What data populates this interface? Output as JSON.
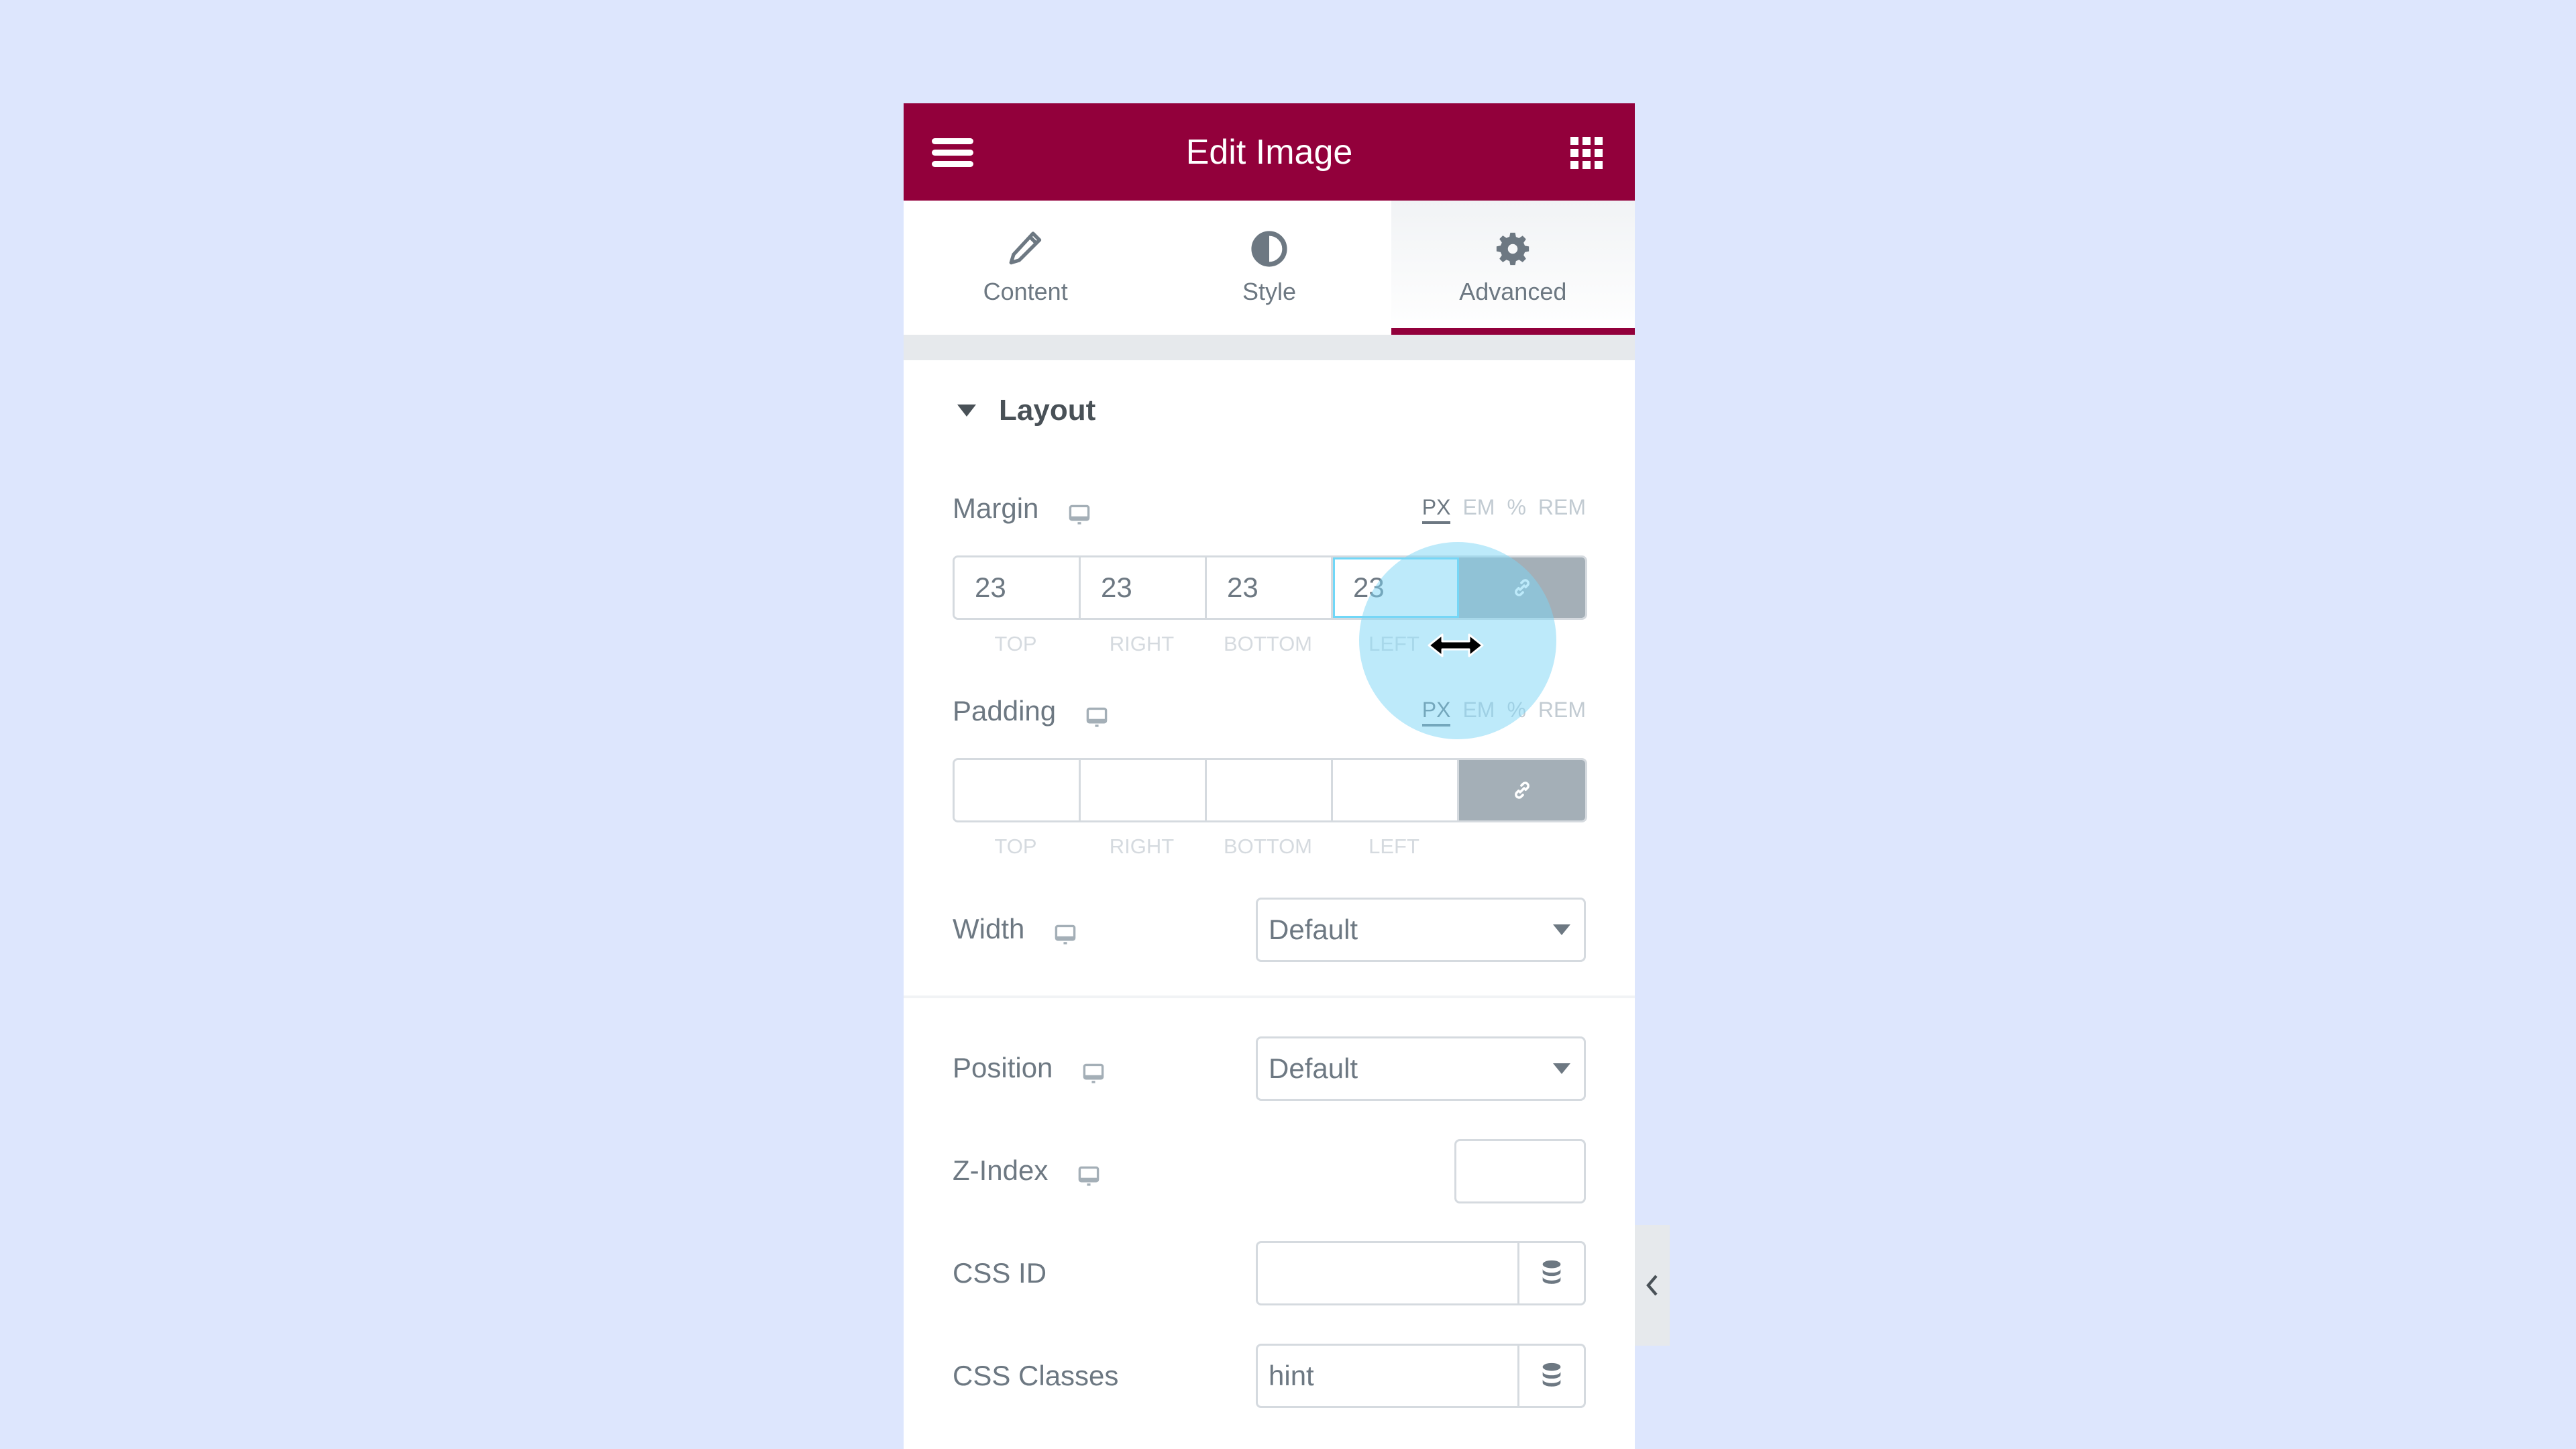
{
  "header": {
    "title": "Edit Image",
    "menu_icon": "hamburger-icon",
    "apps_icon": "grid-icon"
  },
  "tabs": [
    {
      "label": "Content",
      "icon": "pencil-icon",
      "active": false
    },
    {
      "label": "Style",
      "icon": "half-circle-icon",
      "active": false
    },
    {
      "label": "Advanced",
      "icon": "gear-icon",
      "active": true
    }
  ],
  "section": {
    "title": "Layout"
  },
  "margin": {
    "label": "Margin",
    "units": [
      "PX",
      "EM",
      "%",
      "REM"
    ],
    "active_unit": "PX",
    "values": {
      "top": "23",
      "right": "23",
      "bottom": "23",
      "left": "23"
    },
    "dim_labels": [
      "TOP",
      "RIGHT",
      "BOTTOM",
      "LEFT"
    ],
    "focused": "left",
    "linked": true
  },
  "padding": {
    "label": "Padding",
    "units": [
      "PX",
      "EM",
      "%",
      "REM"
    ],
    "active_unit": "PX",
    "values": {
      "top": "",
      "right": "",
      "bottom": "",
      "left": ""
    },
    "dim_labels": [
      "TOP",
      "RIGHT",
      "BOTTOM",
      "LEFT"
    ],
    "linked": true
  },
  "width": {
    "label": "Width",
    "value": "Default"
  },
  "position": {
    "label": "Position",
    "value": "Default"
  },
  "z_index": {
    "label": "Z-Index",
    "value": ""
  },
  "css_id": {
    "label": "CSS ID",
    "value": ""
  },
  "css_classes": {
    "label": "CSS Classes",
    "value": "hint"
  },
  "colors": {
    "brand": "#92003b",
    "text": "#6d7882",
    "border": "#d5dadf",
    "link_button": "#a4afb7",
    "focus": "#71d7f7",
    "background": "#dde6fd"
  }
}
